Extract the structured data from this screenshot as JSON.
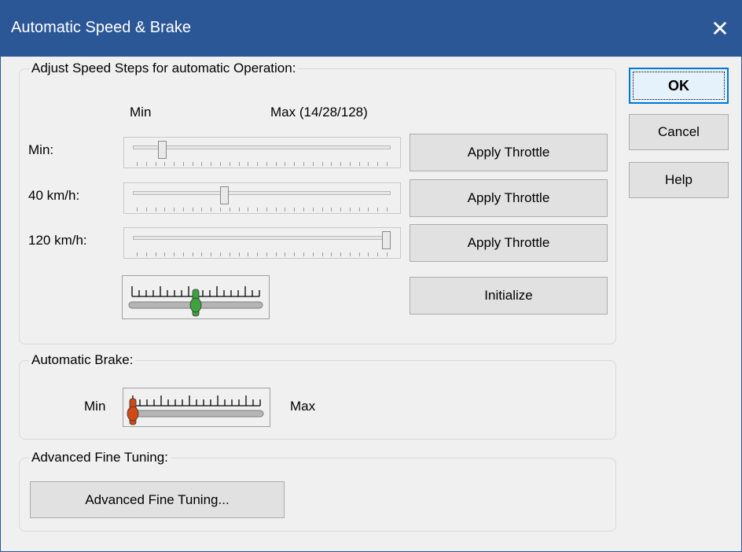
{
  "window": {
    "title": "Automatic Speed & Brake",
    "close_label": "✕"
  },
  "buttons": {
    "ok": "OK",
    "cancel": "Cancel",
    "help": "Help"
  },
  "speed_group": {
    "title": "Adjust Speed Steps for automatic Operation:",
    "min_header": "Min",
    "max_header": "Max (14/28/128)",
    "rows": [
      {
        "label": "Min:",
        "value": 0.1,
        "button": "Apply Throttle"
      },
      {
        "label": "40 km/h:",
        "value": 0.35,
        "button": "Apply Throttle"
      },
      {
        "label": "120 km/h:",
        "value": 1.0,
        "button": "Apply Throttle"
      }
    ],
    "initialize_button": "Initialize",
    "acceleration_level": 0.5,
    "acceleration_color": "#3ea33e"
  },
  "brake_group": {
    "title": "Automatic Brake:",
    "min_label": "Min",
    "max_label": "Max",
    "level": 0.0,
    "color": "#d04a15"
  },
  "fine_group": {
    "title": "Advanced Fine Tuning:",
    "button": "Advanced Fine Tuning..."
  },
  "colors": {
    "titlebar": "#2b5797",
    "dialog": "#f0f0f0",
    "default_button_border": "#0078d7"
  }
}
